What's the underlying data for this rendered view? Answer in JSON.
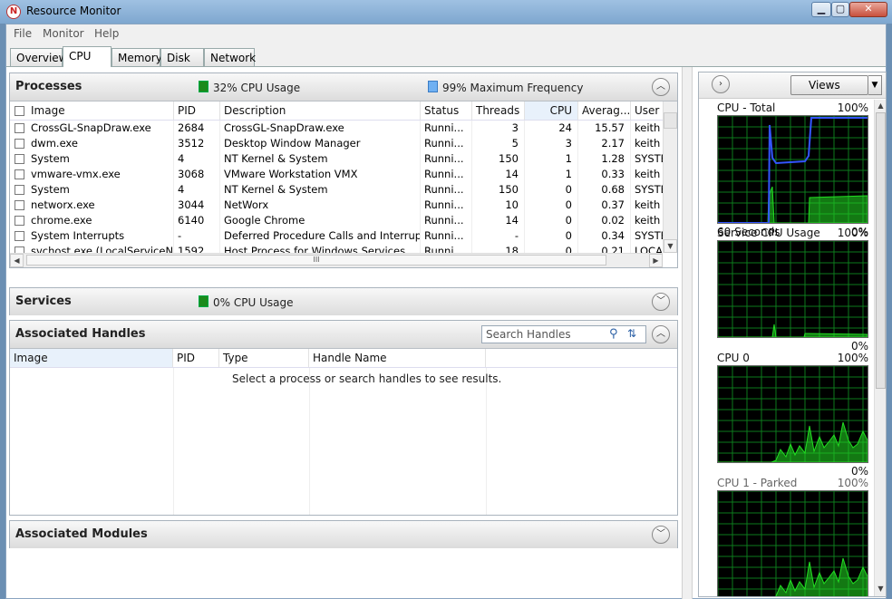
{
  "window": {
    "title": "Resource Monitor"
  },
  "menu": [
    "File",
    "Monitor",
    "Help"
  ],
  "tabs": [
    "Overview",
    "CPU",
    "Memory",
    "Disk",
    "Network"
  ],
  "active_tab": "CPU",
  "colors": {
    "graph_green": "#22dd22",
    "graph_blue": "#3355ff",
    "grid": "#0d7a1d"
  },
  "processes": {
    "title": "Processes",
    "cpu_usage": "32% CPU Usage",
    "max_freq": "99% Maximum Frequency",
    "columns": [
      "Image",
      "PID",
      "Description",
      "Status",
      "Threads",
      "CPU",
      "Averag...",
      "User N"
    ],
    "rows": [
      [
        "CrossGL-SnapDraw.exe",
        "2684",
        "CrossGL-SnapDraw.exe",
        "Runni...",
        "3",
        "24",
        "15.57",
        "keith"
      ],
      [
        "dwm.exe",
        "3512",
        "Desktop Window Manager",
        "Runni...",
        "5",
        "3",
        "2.17",
        "keith"
      ],
      [
        "System",
        "4",
        "NT Kernel & System",
        "Runni...",
        "150",
        "1",
        "1.28",
        "SYSTEI"
      ],
      [
        "vmware-vmx.exe",
        "3068",
        "VMware Workstation VMX",
        "Runni...",
        "14",
        "1",
        "0.33",
        "keith"
      ],
      [
        "System",
        "4",
        "NT Kernel & System",
        "Runni...",
        "150",
        "0",
        "0.68",
        "SYSTEI"
      ],
      [
        "networx.exe",
        "3044",
        "NetWorx",
        "Runni...",
        "10",
        "0",
        "0.37",
        "keith"
      ],
      [
        "chrome.exe",
        "6140",
        "Google Chrome",
        "Runni...",
        "14",
        "0",
        "0.02",
        "keith"
      ],
      [
        "System Interrupts",
        "-",
        "Deferred Procedure Calls and Interrup...",
        "Runni...",
        "-",
        "0",
        "0.34",
        "SYSTEI"
      ],
      [
        "svchost.exe (LocalServiceNo...",
        "1592",
        "Host Process for Windows Services",
        "Runni...",
        "18",
        "0",
        "0.21",
        "LOCAL"
      ]
    ],
    "scroll_glyph": "III"
  },
  "services": {
    "title": "Services",
    "cpu_usage": "0% CPU Usage"
  },
  "handles": {
    "title": "Associated Handles",
    "search_placeholder": "Search Handles",
    "columns": [
      "Image",
      "PID",
      "Type",
      "Handle Name"
    ],
    "empty_message": "Select a process or search handles to see results."
  },
  "modules": {
    "title": "Associated Modules"
  },
  "right_pane": {
    "views_label": "Views",
    "graphs": [
      {
        "label": "CPU - Total",
        "max": "100%",
        "footer_left": "60 Seconds",
        "footer_right": "0%"
      },
      {
        "label": "Service CPU Usage",
        "max": "100%",
        "footer_left": "",
        "footer_right": "0%"
      },
      {
        "label": "CPU 0",
        "max": "100%",
        "footer_left": "",
        "footer_right": "0%"
      },
      {
        "label": "CPU 1 - Parked",
        "max": "100%",
        "footer_left": "",
        "footer_right": ""
      }
    ]
  }
}
